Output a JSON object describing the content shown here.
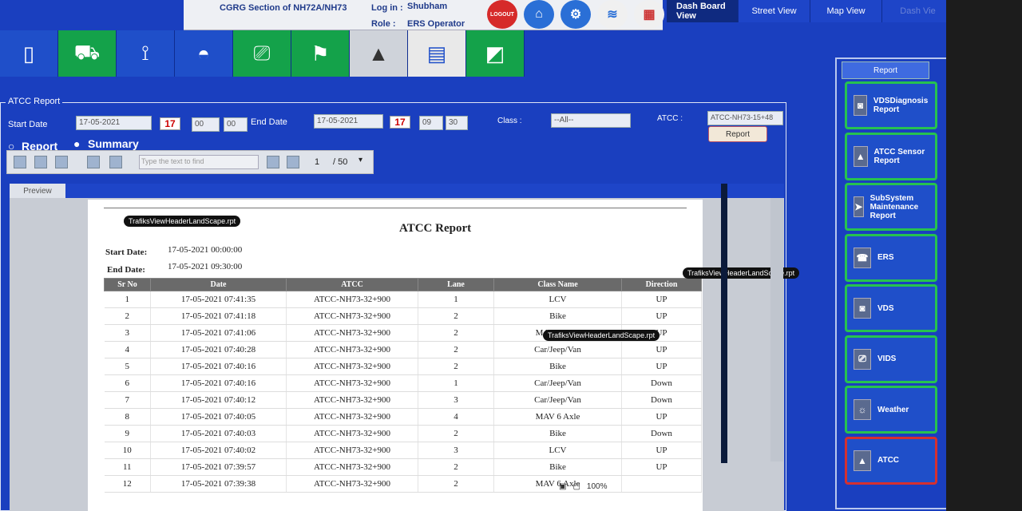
{
  "header": {
    "section": "CGRG Section of NH72A/NH73",
    "login_label": "Log in :",
    "login_value": "Shubham",
    "role_label": "Role :",
    "role_value": "ERS Operator",
    "logout_label": "LOGOUT"
  },
  "tabs": [
    {
      "label": "Dash Board View"
    },
    {
      "label": "Street View"
    },
    {
      "label": "Map View"
    },
    {
      "label": "Dash Vie"
    }
  ],
  "form": {
    "legend": "ATCC Report",
    "start_date_label": "Start Date",
    "start_date": "17-05-2021",
    "start_hh": "00",
    "start_mm": "00",
    "end_date_label": "End Date",
    "end_date": "17-05-2021",
    "end_hh": "09",
    "end_mm": "30",
    "calendar_day": "17",
    "class_label": "Class :",
    "class_value": "--All--",
    "atcc_label": "ATCC :",
    "atcc_value": "ATCC-NH73-15+48",
    "report_button": "Report",
    "radio_report": "Report",
    "radio_summary": "Summary"
  },
  "viewer": {
    "find_placeholder": "Type the text to find",
    "page_current": "1",
    "page_total": "/ 50",
    "preview_tab": "Preview",
    "zoom": "100%"
  },
  "report": {
    "tag": "TrafiksViewHeaderLandScape.rpt",
    "title": "ATCC Report",
    "start_label": "Start Date:",
    "start_value": "17-05-2021  00:00:00",
    "end_label": "End Date:",
    "end_value": "17-05-2021  09:30:00",
    "columns": [
      "Sr No",
      "Date",
      "ATCC",
      "Lane",
      "Class Name",
      "Direction"
    ],
    "rows": [
      [
        "1",
        "17-05-2021  07:41:35",
        "ATCC-NH73-32+900",
        "1",
        "LCV",
        "UP"
      ],
      [
        "2",
        "17-05-2021  07:41:18",
        "ATCC-NH73-32+900",
        "2",
        "Bike",
        "UP"
      ],
      [
        "3",
        "17-05-2021  07:41:06",
        "ATCC-NH73-32+900",
        "2",
        "MAV 4 Axle",
        "UP"
      ],
      [
        "4",
        "17-05-2021  07:40:28",
        "ATCC-NH73-32+900",
        "2",
        "Car/Jeep/Van",
        "UP"
      ],
      [
        "5",
        "17-05-2021  07:40:16",
        "ATCC-NH73-32+900",
        "2",
        "Bike",
        "UP"
      ],
      [
        "6",
        "17-05-2021  07:40:16",
        "ATCC-NH73-32+900",
        "1",
        "Car/Jeep/Van",
        "Down"
      ],
      [
        "7",
        "17-05-2021  07:40:12",
        "ATCC-NH73-32+900",
        "3",
        "Car/Jeep/Van",
        "Down"
      ],
      [
        "8",
        "17-05-2021  07:40:05",
        "ATCC-NH73-32+900",
        "4",
        "MAV 6 Axle",
        "UP"
      ],
      [
        "9",
        "17-05-2021  07:40:03",
        "ATCC-NH73-32+900",
        "2",
        "Bike",
        "Down"
      ],
      [
        "10",
        "17-05-2021  07:40:02",
        "ATCC-NH73-32+900",
        "3",
        "LCV",
        "UP"
      ],
      [
        "11",
        "17-05-2021  07:39:57",
        "ATCC-NH73-32+900",
        "2",
        "Bike",
        "UP"
      ],
      [
        "12",
        "17-05-2021  07:39:38",
        "ATCC-NH73-32+900",
        "2",
        "MAV 6 Axle",
        ""
      ]
    ]
  },
  "sidebar": {
    "header": "Report",
    "items": [
      {
        "label": "VDSDiagnosis Report",
        "icon": "camera-icon"
      },
      {
        "label": "ATCC Sensor Report",
        "icon": "road-icon"
      },
      {
        "label": "SubSystem Maintenance Report",
        "icon": "cursor-icon"
      },
      {
        "label": "ERS",
        "icon": "phone-icon"
      },
      {
        "label": "VDS",
        "icon": "camera-icon"
      },
      {
        "label": "VIDS",
        "icon": "cctv-icon"
      },
      {
        "label": "Weather",
        "icon": "weather-icon"
      },
      {
        "label": "ATCC",
        "icon": "road-icon"
      }
    ]
  },
  "colors": {
    "background": "#1a3fbf",
    "green": "#14a24a",
    "active_border": "#d63030"
  }
}
